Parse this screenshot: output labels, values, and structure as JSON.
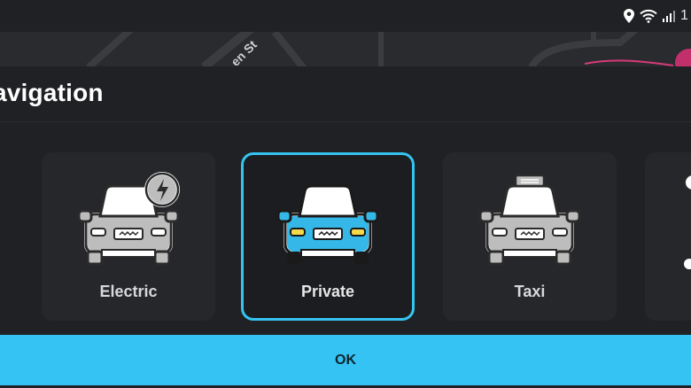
{
  "status_bar": {
    "icons": [
      "location-pin-icon",
      "wifi-icon",
      "signal-icon"
    ],
    "time_partial": "1"
  },
  "map": {
    "street_label": "en St"
  },
  "sheet": {
    "title": "avigation",
    "options": [
      {
        "label": "Electric",
        "icon": "electric-car-icon",
        "selected": false
      },
      {
        "label": "Private",
        "icon": "private-car-icon",
        "selected": true
      },
      {
        "label": "Taxi",
        "icon": "taxi-icon",
        "selected": false
      }
    ],
    "ok_label": "OK"
  },
  "colors": {
    "accent": "#34c3f3",
    "selected_car": "#35b8e8",
    "background": "#202124"
  }
}
